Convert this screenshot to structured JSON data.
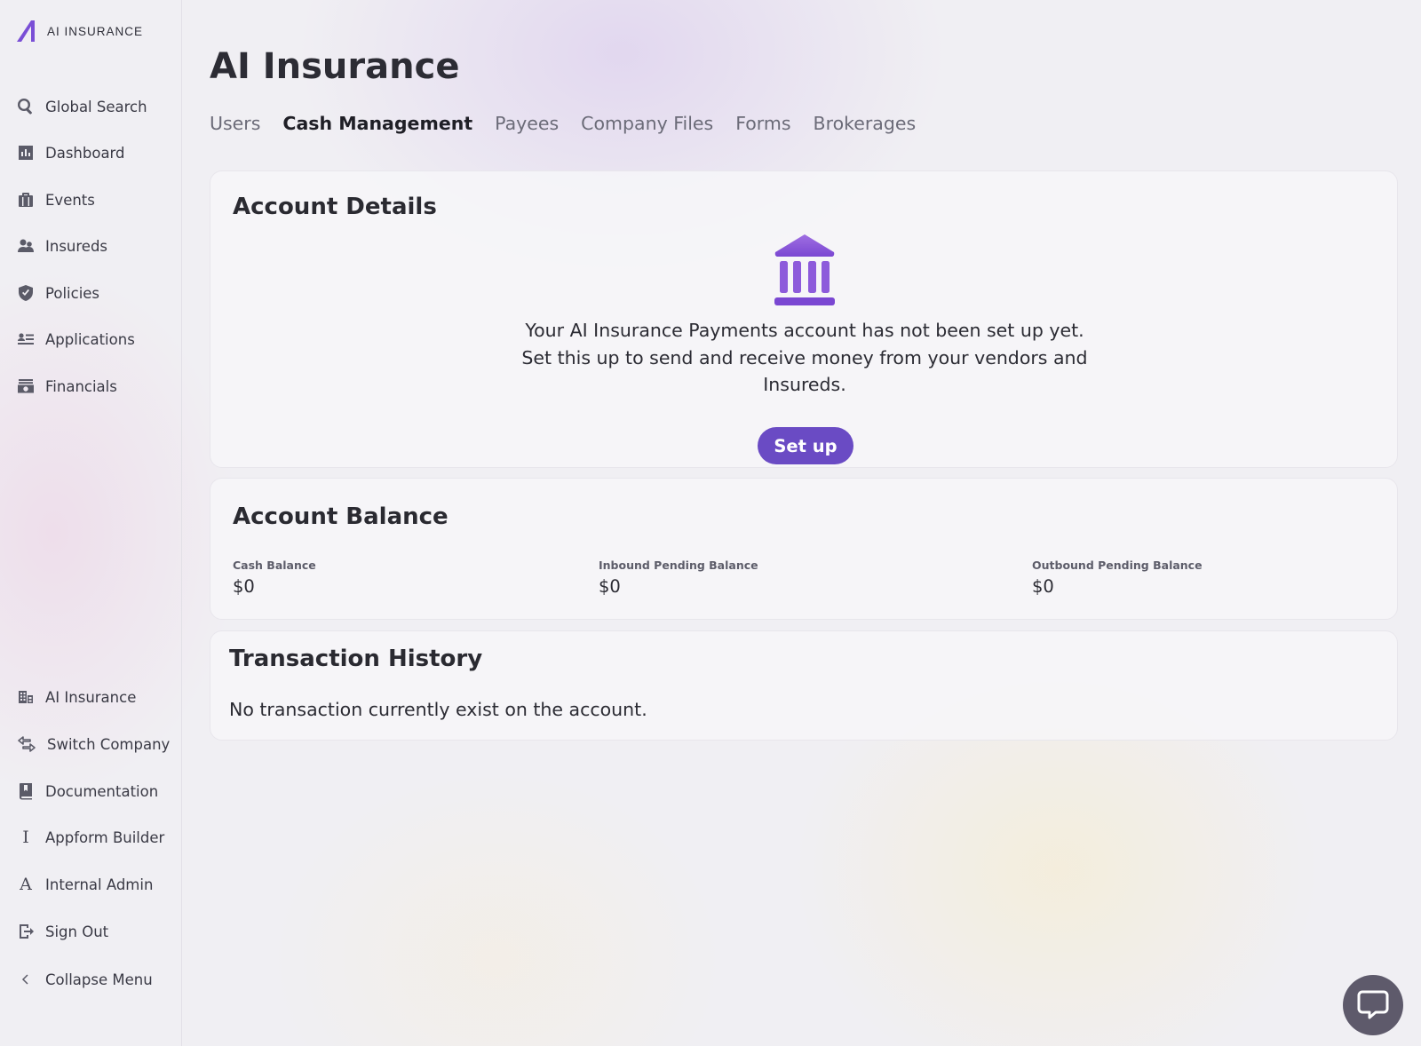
{
  "brand": {
    "logo_text": "AI INSURANCE"
  },
  "sidebar": {
    "primary": [
      {
        "label": "Global Search",
        "icon": "search-icon"
      },
      {
        "label": "Dashboard",
        "icon": "chart-icon"
      },
      {
        "label": "Events",
        "icon": "briefcase-icon"
      },
      {
        "label": "Insureds",
        "icon": "users-icon"
      },
      {
        "label": "Policies",
        "icon": "shield-icon"
      },
      {
        "label": "Applications",
        "icon": "list-icon"
      },
      {
        "label": "Financials",
        "icon": "money-icon"
      }
    ],
    "secondary": [
      {
        "label": "AI Insurance",
        "icon": "building-icon"
      },
      {
        "label": "Switch Company",
        "icon": "switch-icon"
      },
      {
        "label": "Documentation",
        "icon": "book-icon"
      },
      {
        "label": "Appform Builder",
        "icon": "letter-i-icon",
        "glyph": "I"
      },
      {
        "label": "Internal Admin",
        "icon": "letter-a-icon",
        "glyph": "A"
      },
      {
        "label": "Sign Out",
        "icon": "sign-out-icon"
      },
      {
        "label": "Collapse Menu",
        "icon": "chevron-left-icon"
      }
    ]
  },
  "page": {
    "title": "AI Insurance"
  },
  "tabs": [
    {
      "label": "Users",
      "active": false
    },
    {
      "label": "Cash Management",
      "active": true
    },
    {
      "label": "Payees",
      "active": false
    },
    {
      "label": "Company Files",
      "active": false
    },
    {
      "label": "Forms",
      "active": false
    },
    {
      "label": "Brokerages",
      "active": false
    }
  ],
  "account_details": {
    "title": "Account Details",
    "message_lines": [
      "Your AI Insurance Payments account has not been set up yet.",
      "Set this up to send and receive money from your vendors and",
      "Insureds."
    ],
    "button_label": "Set up"
  },
  "account_balance": {
    "title": "Account Balance",
    "items": [
      {
        "label": "Cash Balance",
        "value": "$0"
      },
      {
        "label": "Inbound Pending Balance",
        "value": "$0"
      },
      {
        "label": "Outbound Pending Balance",
        "value": "$0"
      }
    ]
  },
  "transaction_history": {
    "title": "Transaction History",
    "empty_message": "No transaction currently exist on the account."
  },
  "colors": {
    "accent": "#6a4bc4",
    "icon_gradient_top": "#9b6ee0",
    "icon_gradient_bottom": "#7d4ed4",
    "chat_button": "#5e5a6b"
  }
}
